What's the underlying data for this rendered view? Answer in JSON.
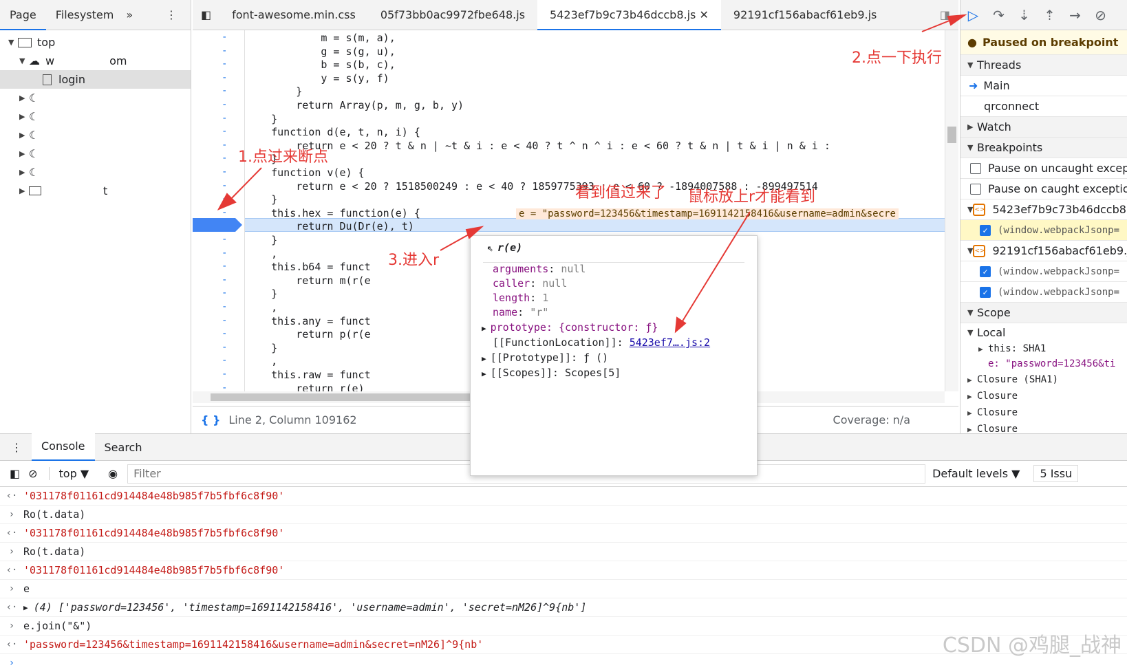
{
  "navigator": {
    "tabs": [
      "Page",
      "Filesystem"
    ],
    "tree": {
      "top": "top",
      "domain_start": "w",
      "domain_end": "om",
      "login": "login",
      "last_item": "t"
    }
  },
  "editor_tabs": [
    "font-awesome.min.css",
    "05f73bb0ac9972fbe648.js",
    "5423ef7b9c73b46dccb8.js",
    "92191cf156abacf61eb9.js"
  ],
  "code": {
    "lines": [
      "            m = s(m, a),",
      "            g = s(g, u),",
      "            b = s(b, c),",
      "            y = s(y, f)",
      "        }",
      "        return Array(p, m, g, b, y)",
      "    }",
      "    function d(e, t, n, i) {",
      "        return e < 20 ? t & n | ~t & i : e < 40 ? t ^ n ^ i : e < 60 ? t & n | t & i | n & i :",
      "    }",
      "    function v(e) {",
      "        return e < 20 ? 1518500249 : e < 40 ? 1859775393 : e < 60 ? -1894007588 : -899497514",
      "    }",
      "    this.hex = function(e) {",
      "        return Du(Dr(e), t)",
      "    }",
      "    ,",
      "    this.b64 = funct",
      "        return m(r(e",
      "    }",
      "    ,",
      "    this.any = funct",
      "        return p(r(e",
      "    }",
      "    ,",
      "    this.raw = funct",
      "        return r(e)"
    ],
    "inline_value": "e = \"password=123456&timestamp=1691142158416&username=admin&secre"
  },
  "status_bar": {
    "position": "Line 2, Column 109162",
    "coverage": "Coverage: n/a"
  },
  "debugger": {
    "paused_message": "Paused on breakpoint",
    "threads_label": "Threads",
    "threads": [
      "Main",
      "qrconnect"
    ],
    "watch_label": "Watch",
    "breakpoints_label": "Breakpoints",
    "pause_uncaught": "Pause on uncaught exceptions",
    "pause_caught": "Pause on caught exceptions",
    "bp_file_1": "5423ef7b9c73b46dccb8.js",
    "bp_file_1_line": "(window.webpackJsonp=",
    "bp_file_2": "92191cf156abacf61eb9.js",
    "bp_file_2_line_1": "(window.webpackJsonp=",
    "bp_file_2_line_2": "(window.webpackJsonp=",
    "scope_label": "Scope",
    "local_label": "Local",
    "local_this": "this: SHA1",
    "local_e": "e: \"password=123456&ti",
    "closures": [
      "Closure (SHA1)",
      "Closure",
      "Closure",
      "Closure"
    ]
  },
  "popover": {
    "title": "r(e)",
    "rows": [
      {
        "k": "arguments",
        "v": "null"
      },
      {
        "k": "caller",
        "v": "null"
      },
      {
        "k": "length",
        "v": "1"
      },
      {
        "k": "name",
        "v": "\"r\""
      }
    ],
    "prototype": "prototype: {constructor: ƒ}",
    "function_location_label": "[[FunctionLocation]]:",
    "function_location_link": "5423ef7….js:2",
    "proto_row": "[[Prototype]]: ƒ ()",
    "scopes_row": "[[Scopes]]: Scopes[5]"
  },
  "console": {
    "tabs": [
      "Console",
      "Search"
    ],
    "context": "top",
    "filter_placeholder": "Filter",
    "levels": "Default levels",
    "issues": "5 Issu",
    "log": [
      {
        "type": "result",
        "text": "'031178f01161cd914484e48b985f7b5fbf6c8f90'"
      },
      {
        "type": "input",
        "text": "Ro(t.data)"
      },
      {
        "type": "result",
        "text": "'031178f01161cd914484e48b985f7b5fbf6c8f90'"
      },
      {
        "type": "input",
        "text": "Ro(t.data)"
      },
      {
        "type": "result",
        "text": "'031178f01161cd914484e48b985f7b5fbf6c8f90'"
      },
      {
        "type": "input",
        "text": "e"
      },
      {
        "type": "array",
        "text": "(4) ['password=123456', 'timestamp=1691142158416', 'username=admin', 'secret=nM26]^9{nb']"
      },
      {
        "type": "input",
        "text": "e.join(\"&\")"
      },
      {
        "type": "result",
        "text": "'password=123456&timestamp=1691142158416&username=admin&secret=nM26]^9{nb'"
      }
    ]
  },
  "annotations": {
    "a1": "1.点过来断点",
    "a2": "2.点一下执行",
    "a3": "3.进入r",
    "a4": "看到值过来了",
    "a5": "鼠标放上r才能看到"
  },
  "watermark": "CSDN @鸡腿_战神",
  "colors": {
    "accent": "#1a73e8",
    "annotation": "#e53935",
    "string": "#c41a16",
    "keyword": "#881280"
  }
}
